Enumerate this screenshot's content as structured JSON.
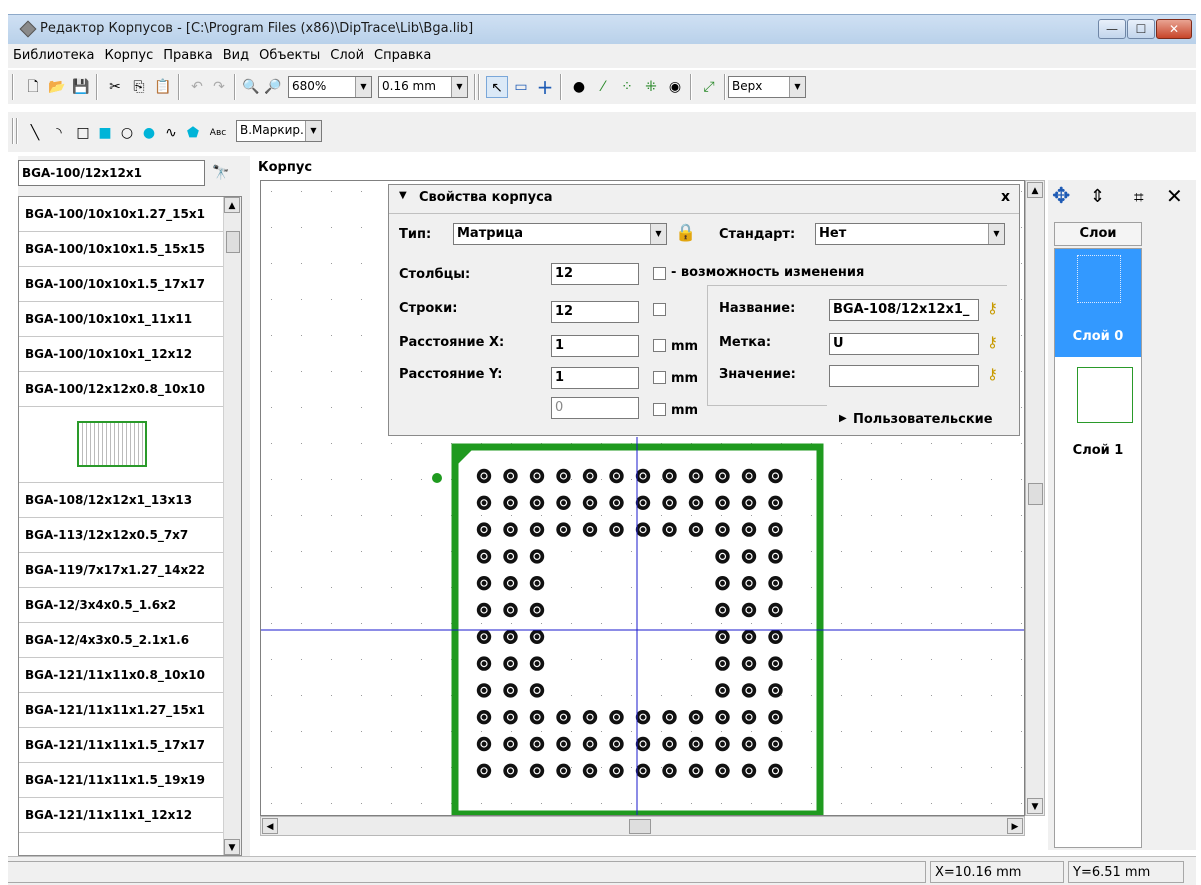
{
  "window": {
    "title": "Редактор Корпусов - [C:\\Program Files (x86)\\DipTrace\\Lib\\Bga.lib]",
    "controls": {
      "minimize": "—",
      "maximize": "☐",
      "close": "✕"
    }
  },
  "menu": [
    "Библиотека",
    "Корпус",
    "Правка",
    "Вид",
    "Объекты",
    "Слой",
    "Справка"
  ],
  "toolbar1": {
    "zoom_value": "680%",
    "grid_value": "0.16 mm",
    "side_value": "Верх"
  },
  "toolbar2": {
    "text_tool": "Aвс",
    "layer_value": "В.Маркир."
  },
  "left_panel": {
    "search_value": "BGA-100/12x12x1",
    "items_before": [
      "BGA-100/10x10x1.27_15x1",
      "BGA-100/10x10x1.5_15x15",
      "BGA-100/10x10x1.5_17x17",
      "BGA-100/10x10x1_11x11",
      "BGA-100/10x10x1_12x12",
      "BGA-100/12x12x0.8_10x10"
    ],
    "items_after": [
      "BGA-108/12x12x1_13x13",
      "BGA-113/12x12x0.5_7x7",
      "BGA-119/7x17x1.27_14x22",
      "BGA-12/3x4x0.5_1.6x2",
      "BGA-12/4x3x0.5_2.1x1.6",
      "BGA-121/11x11x0.8_10x10",
      "BGA-121/11x11x1.27_15x1",
      "BGA-121/11x11x1.5_17x17",
      "BGA-121/11x11x1.5_19x19",
      "BGA-121/11x11x1_12x12"
    ]
  },
  "canvas": {
    "group_label": "Корпус",
    "pad_color": "#111111",
    "outline_color": "#1f9a1f",
    "crosshair_color": "#1a1acc"
  },
  "properties": {
    "title": "Свойства корпуса",
    "close": "x",
    "type_label": "Тип:",
    "type_value": "Матрица",
    "standard_label": "Стандарт:",
    "standard_value": "Нет",
    "columns_label": "Столбцы:",
    "columns_value": "12",
    "resize_label": "- возможность изменения",
    "rows_label": "Строки:",
    "rows_value": "12",
    "spacing_x_label": "Расстояние X:",
    "spacing_x_value": "1",
    "spacing_y_label": "Расстояние Y:",
    "spacing_y_value": "1",
    "extra_value": "0",
    "unit": "mm",
    "name_label": "Название:",
    "name_value": "BGA-108/12x12x1_",
    "ref_label": "Метка:",
    "ref_value": "U",
    "value_label": "Значение:",
    "value_value": "",
    "custom_label": "Пользовательские"
  },
  "layers": {
    "header": "Слои",
    "items": [
      "Слой 0",
      "Слой 1"
    ],
    "selected_color": "#3399ff"
  },
  "status": {
    "x": "X=10.16 mm",
    "y": "Y=6.51 mm"
  }
}
